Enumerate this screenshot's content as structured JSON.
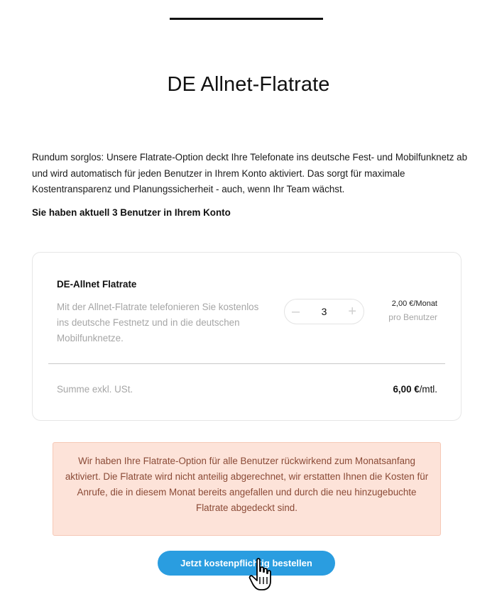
{
  "header": {
    "title": "DE Allnet-Flatrate"
  },
  "intro": {
    "text": "Rundum sorglos: Unsere Flatrate-Option deckt Ihre Telefonate ins deutsche Fest- und Mobilfunknetz ab und wird automatisch für jeden Benutzer in Ihrem Konto aktiviert. Das sorgt für maximale Kostentransparenz und Planungssicherheit - auch, wenn Ihr Team wächst.",
    "user_count": "Sie haben aktuell 3 Benutzer in Ihrem Konto"
  },
  "card": {
    "product_name": "DE-Allnet Flatrate",
    "description": "Mit der Allnet-Flatrate telefonieren Sie kostenlos ins deutsche Festnetz und in die deutschen Mobilfunknetze.",
    "stepper": {
      "minus": "–",
      "value": "3",
      "plus": "+"
    },
    "price": "2,00 €/Monat",
    "price_unit": "pro Benutzer",
    "sum_label": "Summe exkl. USt.",
    "sum_amount": "6,00 €",
    "sum_suffix": "/mtl."
  },
  "notice": {
    "text": "Wir haben Ihre Flatrate-Option für alle Benutzer rückwirkend zum Monatsanfang aktiviert. Die Flatrate wird nicht anteilig abgerechnet, wir erstatten Ihnen die Kosten für Anrufe, die in diesem Monat bereits angefallen und durch die neu hinzugebuchte Flatrate abgedeckt sind."
  },
  "actions": {
    "order_label": "Jetzt kostenpflichtig bestellen"
  },
  "colors": {
    "accent": "#2a9de0",
    "notice_bg": "#fde3d9",
    "notice_text": "#8a4a36",
    "muted_text": "#a6a6a6"
  },
  "icons": {
    "cursor": "hand-pointer-icon"
  }
}
